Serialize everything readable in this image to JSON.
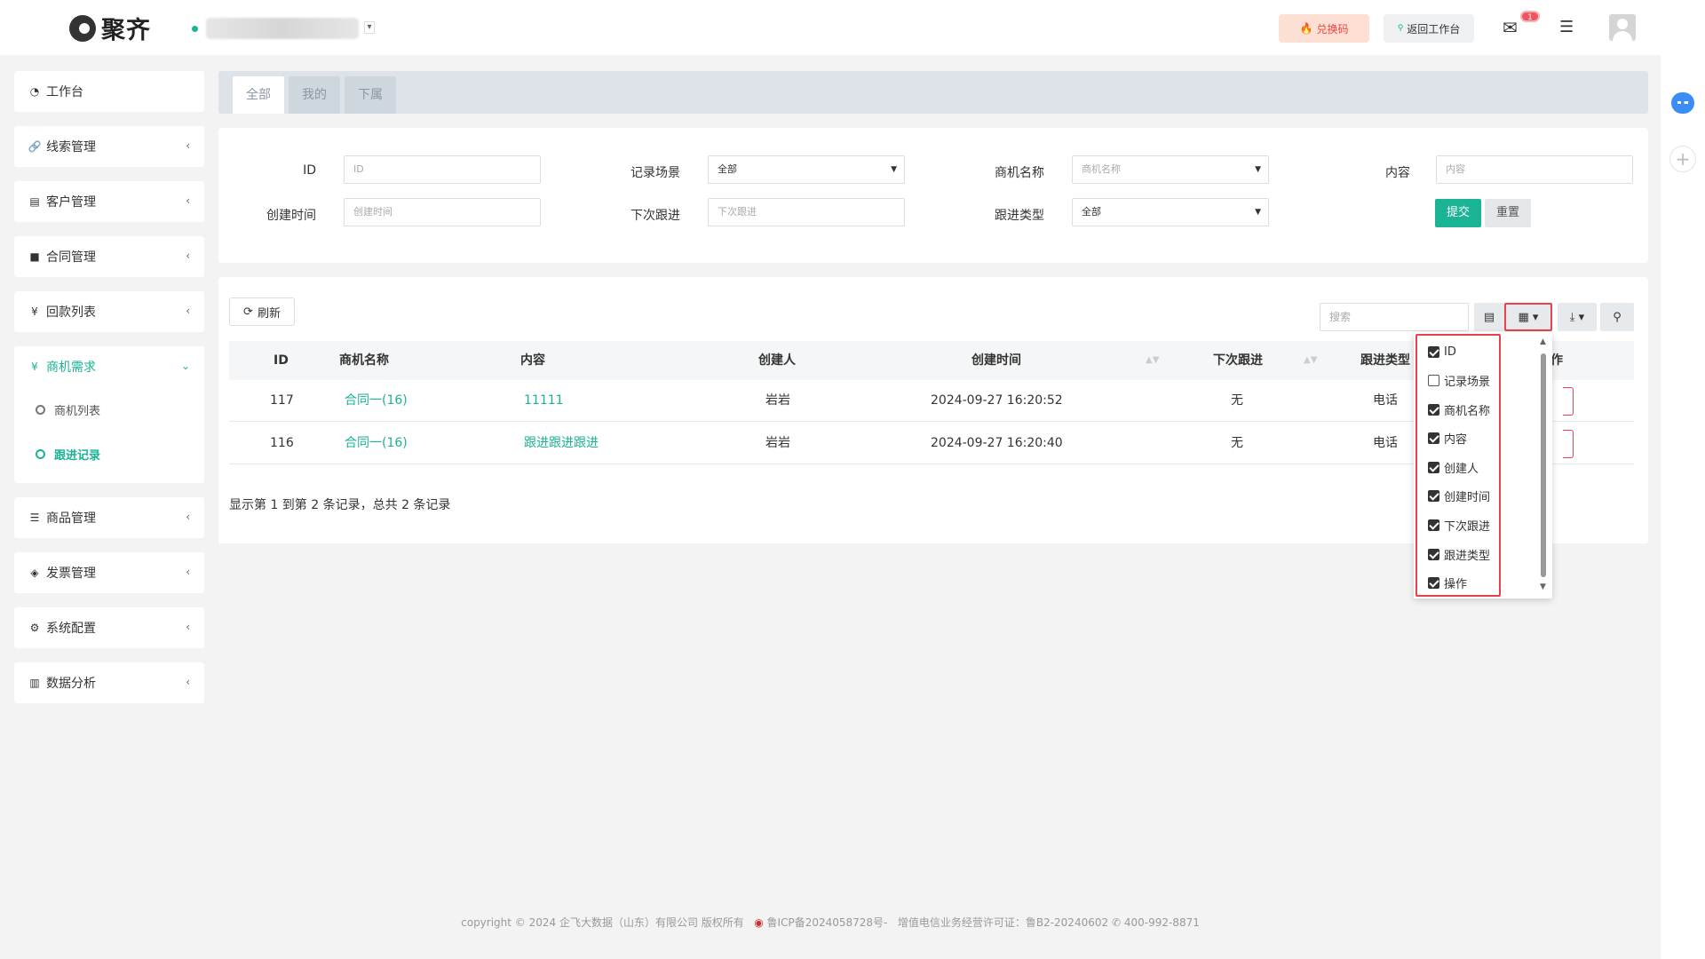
{
  "header": {
    "brand": "聚齐",
    "redeem_label": "兑换码",
    "back_label": "返回工作台",
    "mail_badge": "1"
  },
  "sidebar": {
    "items": [
      {
        "label": "工作台",
        "icon": "dashboard-icon"
      },
      {
        "label": "线索管理",
        "icon": "link-icon"
      },
      {
        "label": "客户管理",
        "icon": "id-card-icon"
      },
      {
        "label": "合同管理",
        "icon": "bookmark-icon"
      },
      {
        "label": "回款列表",
        "icon": "yen-icon"
      }
    ],
    "active_group": {
      "label": "商机需求",
      "icon": "yen-icon",
      "sub_items": [
        {
          "label": "商机列表"
        },
        {
          "label": "跟进记录"
        }
      ]
    },
    "items_after": [
      {
        "label": "商品管理",
        "icon": "list-icon"
      },
      {
        "label": "发票管理",
        "icon": "ticket-icon"
      },
      {
        "label": "系统配置",
        "icon": "gears-icon"
      },
      {
        "label": "数据分析",
        "icon": "bar-chart-icon"
      }
    ]
  },
  "tabs": [
    "全部",
    "我的",
    "下属"
  ],
  "filters": {
    "id_label": "ID",
    "id_placeholder": "ID",
    "scene_label": "记录场景",
    "scene_value": "全部",
    "opportunity_label": "商机名称",
    "opportunity_placeholder": "商机名称",
    "content_label": "内容",
    "content_placeholder": "内容",
    "created_label": "创建时间",
    "created_placeholder": "创建时间",
    "next_label": "下次跟进",
    "next_placeholder": "下次跟进",
    "type_label": "跟进类型",
    "type_value": "全部",
    "submit_label": "提交",
    "reset_label": "重置"
  },
  "toolbar": {
    "refresh_label": "刷新",
    "search_placeholder": "搜索"
  },
  "table": {
    "columns": [
      "ID",
      "商机名称",
      "内容",
      "创建人",
      "创建时间",
      "下次跟进",
      "跟进类型",
      "作"
    ],
    "rows": [
      {
        "id": "117",
        "opportunity": "合同一(16)",
        "content": "11111",
        "creator": "岩岩",
        "created": "2024-09-27 16:20:52",
        "next": "无",
        "type": "电话"
      },
      {
        "id": "116",
        "opportunity": "合同一(16)",
        "content": "跟进跟进跟进",
        "creator": "岩岩",
        "created": "2024-09-27 16:20:40",
        "next": "无",
        "type": "电话"
      }
    ],
    "pagination_text": "显示第 1 到第 2 条记录，总共 2 条记录"
  },
  "column_menu": [
    {
      "label": "ID",
      "checked": true
    },
    {
      "label": "记录场景",
      "checked": false
    },
    {
      "label": "商机名称",
      "checked": true
    },
    {
      "label": "内容",
      "checked": true
    },
    {
      "label": "创建人",
      "checked": true
    },
    {
      "label": "创建时间",
      "checked": true
    },
    {
      "label": "下次跟进",
      "checked": true
    },
    {
      "label": "跟进类型",
      "checked": true
    },
    {
      "label": "操作",
      "checked": true
    }
  ],
  "footer": {
    "copyright": "copyright © 2024 企飞大数据（山东）有限公司 版权所有",
    "icp": "鲁ICP备2024058728号-",
    "license": "增值电信业务经营许可证：鲁B2-20240602",
    "phone": "400-992-8871"
  },
  "colors": {
    "accent": "#1ab394",
    "highlight": "#e8424d"
  }
}
